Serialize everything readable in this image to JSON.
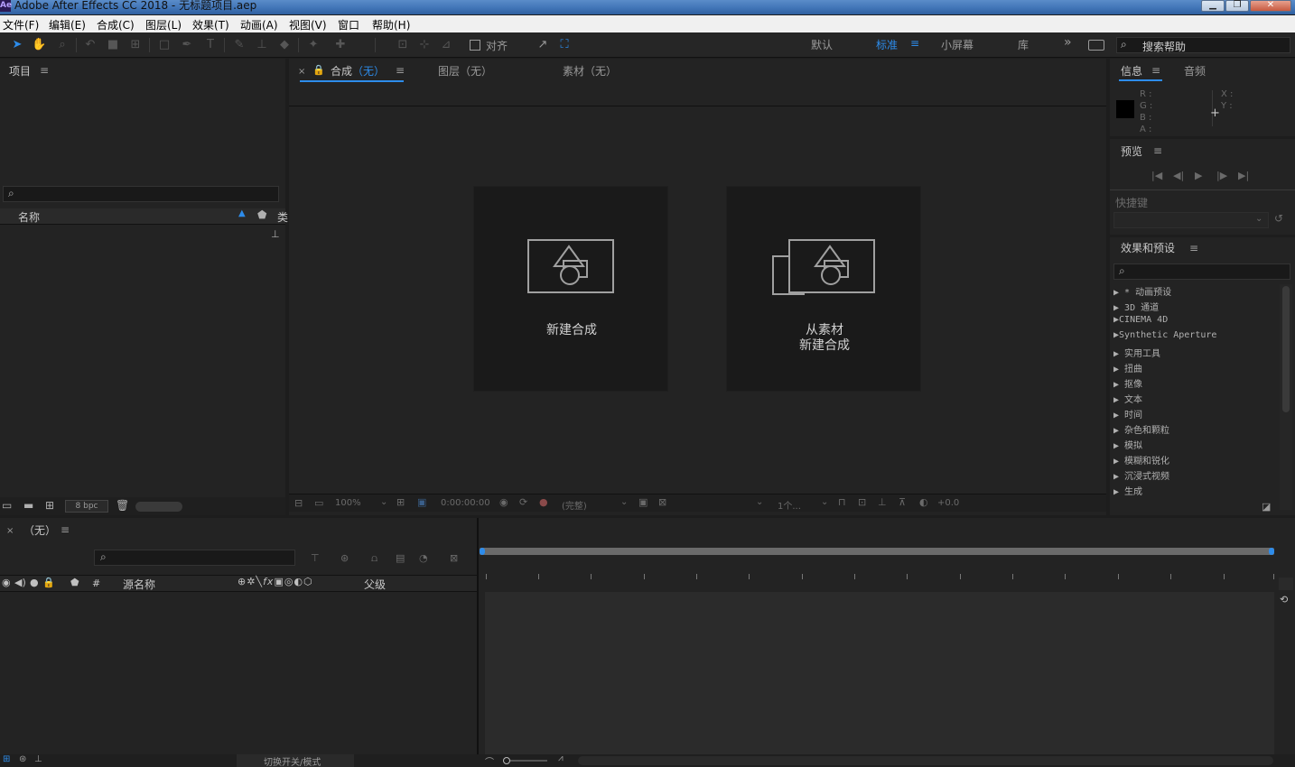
{
  "window": {
    "title": "Adobe After Effects CC 2018 - 无标题项目.aep",
    "logo": "Ae",
    "controls": {
      "minimize": "▁",
      "maximize": "❐",
      "close": "✕"
    }
  },
  "menu": [
    "文件(F)",
    "编辑(E)",
    "合成(C)",
    "图层(L)",
    "效果(T)",
    "动画(A)",
    "视图(V)",
    "窗口",
    "帮助(H)"
  ],
  "toolbar": {
    "snap_label": "对齐",
    "workspaces": {
      "default": "默认",
      "standard": "标准",
      "small_screen": "小屏幕",
      "library": "库"
    },
    "more": "»",
    "search_help_placeholder": "搜索帮助"
  },
  "project_panel": {
    "title": "项目",
    "menu_icon": "≡",
    "column_name": "名称",
    "column_type_abbrev": "类",
    "bpc": "8 bpc"
  },
  "composition_panel": {
    "tabs": [
      {
        "prefix": "合成",
        "value": "（无）"
      },
      {
        "prefix": "图层",
        "value": "（无）"
      },
      {
        "prefix": "素材",
        "value": "（无）"
      }
    ],
    "new_comp_label": "新建合成",
    "from_footage_line1": "从素材",
    "from_footage_line2": "新建合成",
    "footer": {
      "zoom": "100%",
      "timecode": "0:00:00:00",
      "quality": "(完整)",
      "views": "1个...",
      "exposure": "+0.0"
    }
  },
  "info_panel": {
    "tabs": [
      "信息",
      "音频"
    ],
    "channels": {
      "r": "R :",
      "g": "G :",
      "b": "B :",
      "a": "A :",
      "x": "X :",
      "y": "Y :"
    }
  },
  "preview_panel": {
    "title": "预览",
    "shortcut_label": "快捷键"
  },
  "effects_panel": {
    "title": "效果和预设",
    "items": [
      "* 动画预设",
      "3D 通道",
      "CINEMA 4D",
      "Synthetic Aperture",
      "实用工具",
      "扭曲",
      "抠像",
      "文本",
      "时间",
      "杂色和颗粒",
      "模拟",
      "模糊和锐化",
      "沉浸式视频",
      "生成"
    ]
  },
  "timeline": {
    "tab_value": "（无）",
    "columns": {
      "hash": "#",
      "source_name": "源名称",
      "parent": "父级"
    },
    "toggle_label": "切换开关/模式"
  },
  "colors": {
    "accent": "#2d8ceb",
    "panel": "#232323",
    "background": "#1d1d1d"
  }
}
